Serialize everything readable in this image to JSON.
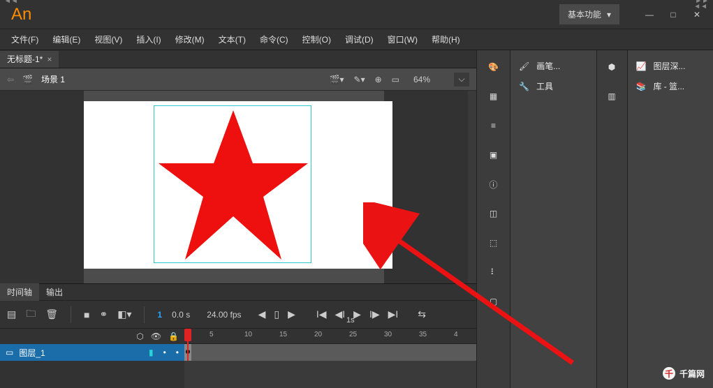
{
  "app": {
    "logo": "An"
  },
  "titlebar": {
    "workspace": "基本功能"
  },
  "menu": {
    "file": "文件(F)",
    "edit": "编辑(E)",
    "view": "视图(V)",
    "insert": "插入(I)",
    "modify": "修改(M)",
    "text": "文本(T)",
    "commands": "命令(C)",
    "control": "控制(O)",
    "debug": "调试(D)",
    "window": "窗口(W)",
    "help": "帮助(H)"
  },
  "document": {
    "tab": "无标题-1*"
  },
  "scenebar": {
    "label": "场景 1",
    "zoom": "64%"
  },
  "timeline": {
    "tab_timeline": "时间轴",
    "tab_output": "输出",
    "frame": "1",
    "time": "0.0 s",
    "fps": "24.00 fps",
    "sec_label": "1s",
    "ticks": [
      "5",
      "10",
      "15",
      "20",
      "25",
      "30",
      "35",
      "4"
    ],
    "layer": "图层_1"
  },
  "panels": {
    "brush": "画笔...",
    "tools": "工具",
    "layer_depth": "图层深...",
    "library": "库 - 篮..."
  },
  "watermark": {
    "text": "千篇网",
    "badge": "千"
  }
}
